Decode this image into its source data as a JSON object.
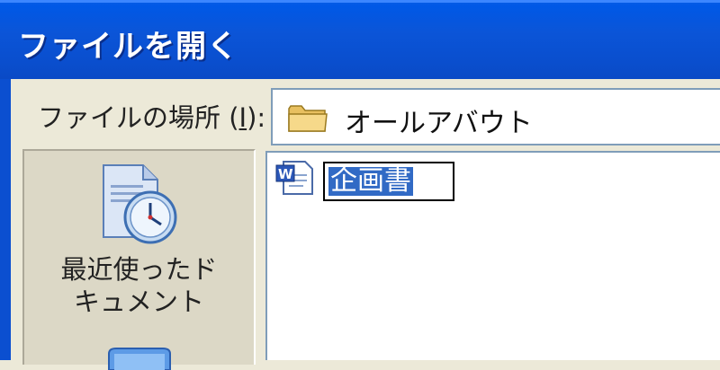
{
  "window": {
    "title": "ファイルを開く"
  },
  "look_in": {
    "label_main": "ファイルの場所 (",
    "label_key": "I",
    "label_end": "):",
    "value": "オールアバウト",
    "icon": "folder-icon"
  },
  "places_bar": {
    "items": [
      {
        "label_line1": "最近使ったド",
        "label_line2": "キュメント",
        "icon": "recent-documents-icon"
      }
    ]
  },
  "file_list": {
    "items": [
      {
        "name": "企画書",
        "icon": "word-document-icon",
        "renaming": true
      }
    ]
  },
  "colors": {
    "titlebar": "#0a53d6",
    "dialog_bg": "#ece9d8",
    "selection": "#316ac5"
  }
}
